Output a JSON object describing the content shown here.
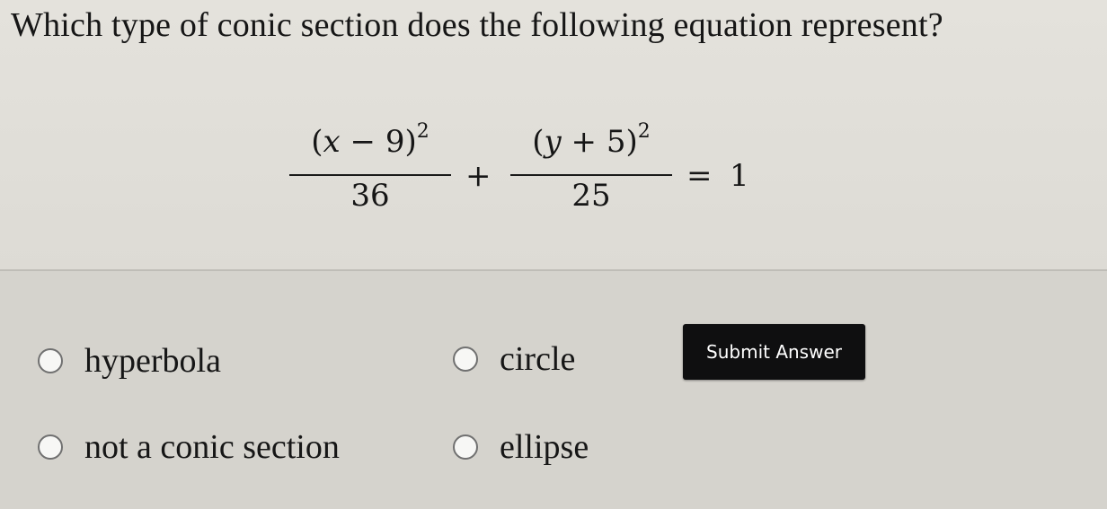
{
  "question": {
    "text": "Which type of conic section does the following equation represent?"
  },
  "equation": {
    "term1_var": "x",
    "term1_op": "−",
    "term1_const": "9",
    "term1_exp": "2",
    "term1_den": "36",
    "plus": "+",
    "term2_var": "y",
    "term2_op": "+",
    "term2_const": "5",
    "term2_exp": "2",
    "term2_den": "25",
    "equals": "=",
    "rhs": "1"
  },
  "options": [
    {
      "label": "hyperbola",
      "selected": false
    },
    {
      "label": "circle",
      "selected": false
    },
    {
      "label": "not a conic section",
      "selected": false
    },
    {
      "label": "ellipse",
      "selected": false
    }
  ],
  "submit": {
    "label": "Submit Answer"
  }
}
